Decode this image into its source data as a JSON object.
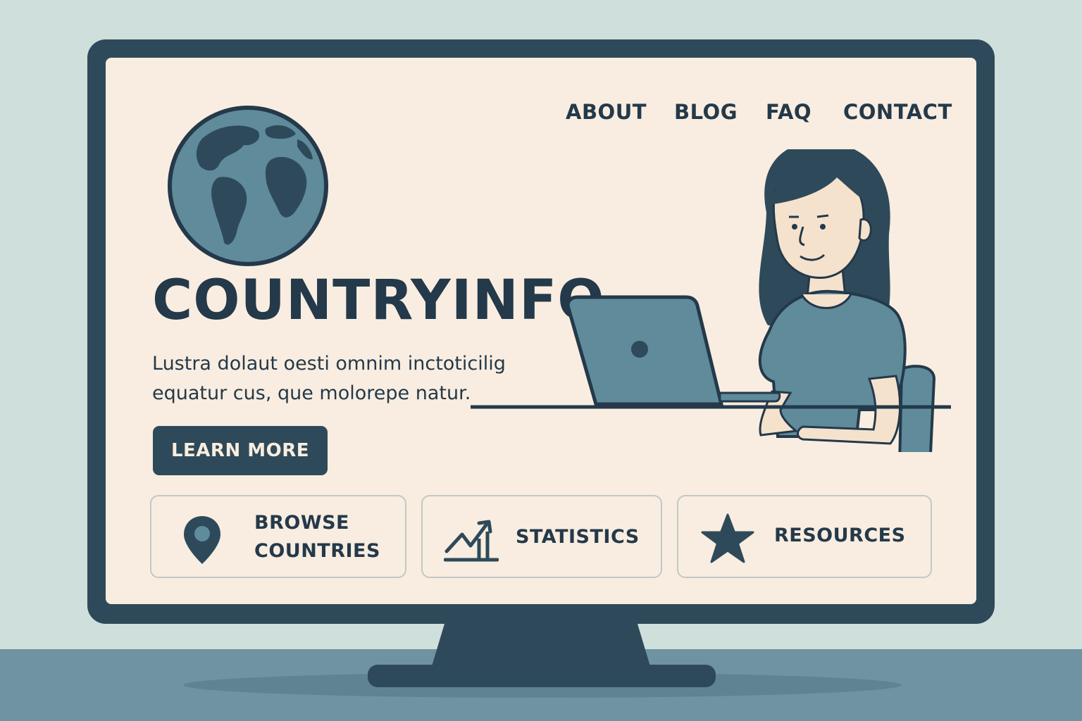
{
  "nav": {
    "items": [
      {
        "label": "ABOUT"
      },
      {
        "label": "BLOG"
      },
      {
        "label": "FAQ"
      },
      {
        "label": "CONTACT"
      }
    ]
  },
  "hero": {
    "title": "COUNTRYINFO",
    "tagline_line1": "Lustra dolaut oesti omnim inctoticilig",
    "tagline_line2": "equatur cus, que molorepe natur.",
    "cta_label": "LEARN MORE"
  },
  "cards": [
    {
      "icon": "map-pin-icon",
      "label_line1": "BROWSE",
      "label_line2": "COUNTRIES"
    },
    {
      "icon": "chart-trend-icon",
      "label": "STATISTICS"
    },
    {
      "icon": "star-icon",
      "label": "RESOURCES"
    }
  ],
  "colors": {
    "dark_navy": "#2e4a5a",
    "text_navy": "#24394a",
    "screen_cream": "#f8ede0",
    "accent_teal": "#5f8b9b",
    "background_mint": "#cfdfdc"
  }
}
